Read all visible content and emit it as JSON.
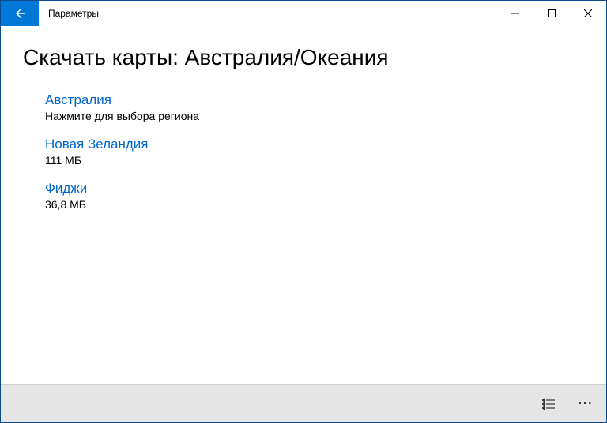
{
  "window": {
    "title": "Параметры"
  },
  "page": {
    "heading": "Скачать карты: Австралия/Океания"
  },
  "maps": [
    {
      "name": "Австралия",
      "sub": "Нажмите для выбора региона"
    },
    {
      "name": "Новая Зеландия",
      "sub": "111 МБ"
    },
    {
      "name": "Фиджи",
      "sub": "36,8 МБ"
    }
  ]
}
